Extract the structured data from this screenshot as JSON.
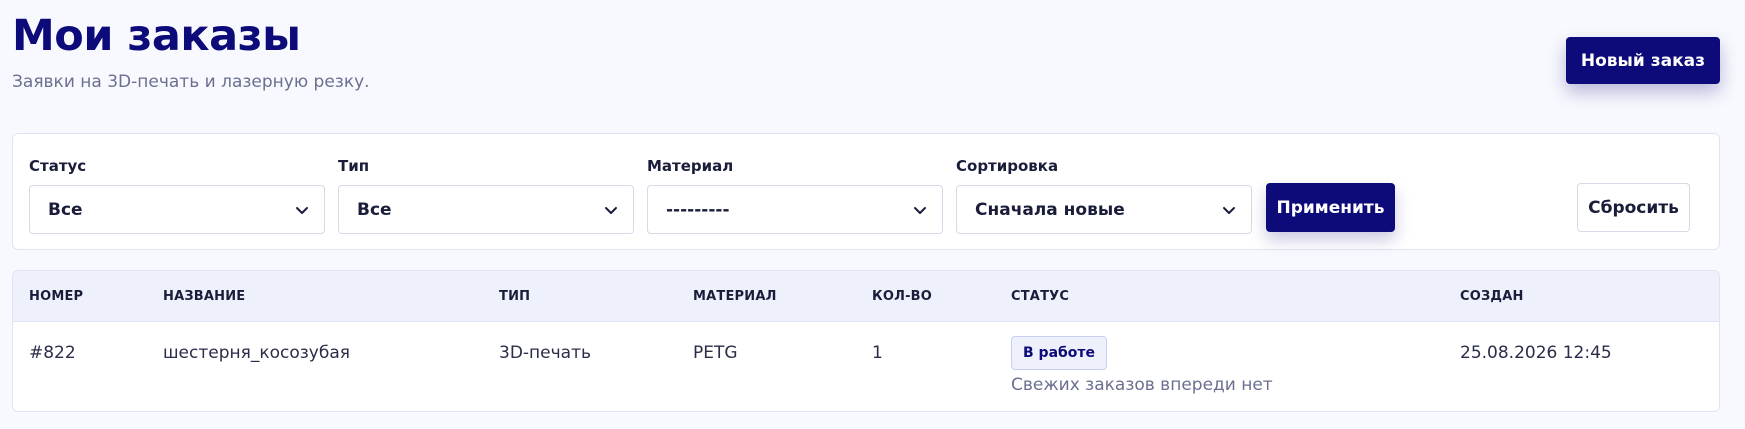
{
  "header": {
    "title": "Мои заказы",
    "subtitle": "Заявки на 3D-печать и лазерную резку.",
    "new_order_label": "Новый заказ"
  },
  "filters": {
    "status": {
      "label": "Статус",
      "value": "Все"
    },
    "type": {
      "label": "Тип",
      "value": "Все"
    },
    "material": {
      "label": "Материал",
      "value": "---------"
    },
    "sort": {
      "label": "Сортировка",
      "value": "Сначала новые"
    },
    "apply_label": "Применить",
    "reset_label": "Сбросить"
  },
  "table": {
    "columns": [
      "Номер",
      "Название",
      "Тип",
      "Материал",
      "Кол-во",
      "Статус",
      "Создан"
    ],
    "rows": [
      {
        "number": "#822",
        "name": "шестерня_косозубая",
        "type": "3D-печать",
        "material": "PETG",
        "quantity": "1",
        "status": "В работе",
        "status_note": "Свежих заказов впереди нет",
        "created": "25.08.2026 12:45"
      }
    ]
  },
  "icons": {
    "select_chevron": "chevron-down-icon"
  },
  "colors": {
    "primary": "#0d0a7a",
    "background": "#f8f9fe",
    "muted_text": "#6b7090",
    "badge_background": "#eef1fc"
  }
}
